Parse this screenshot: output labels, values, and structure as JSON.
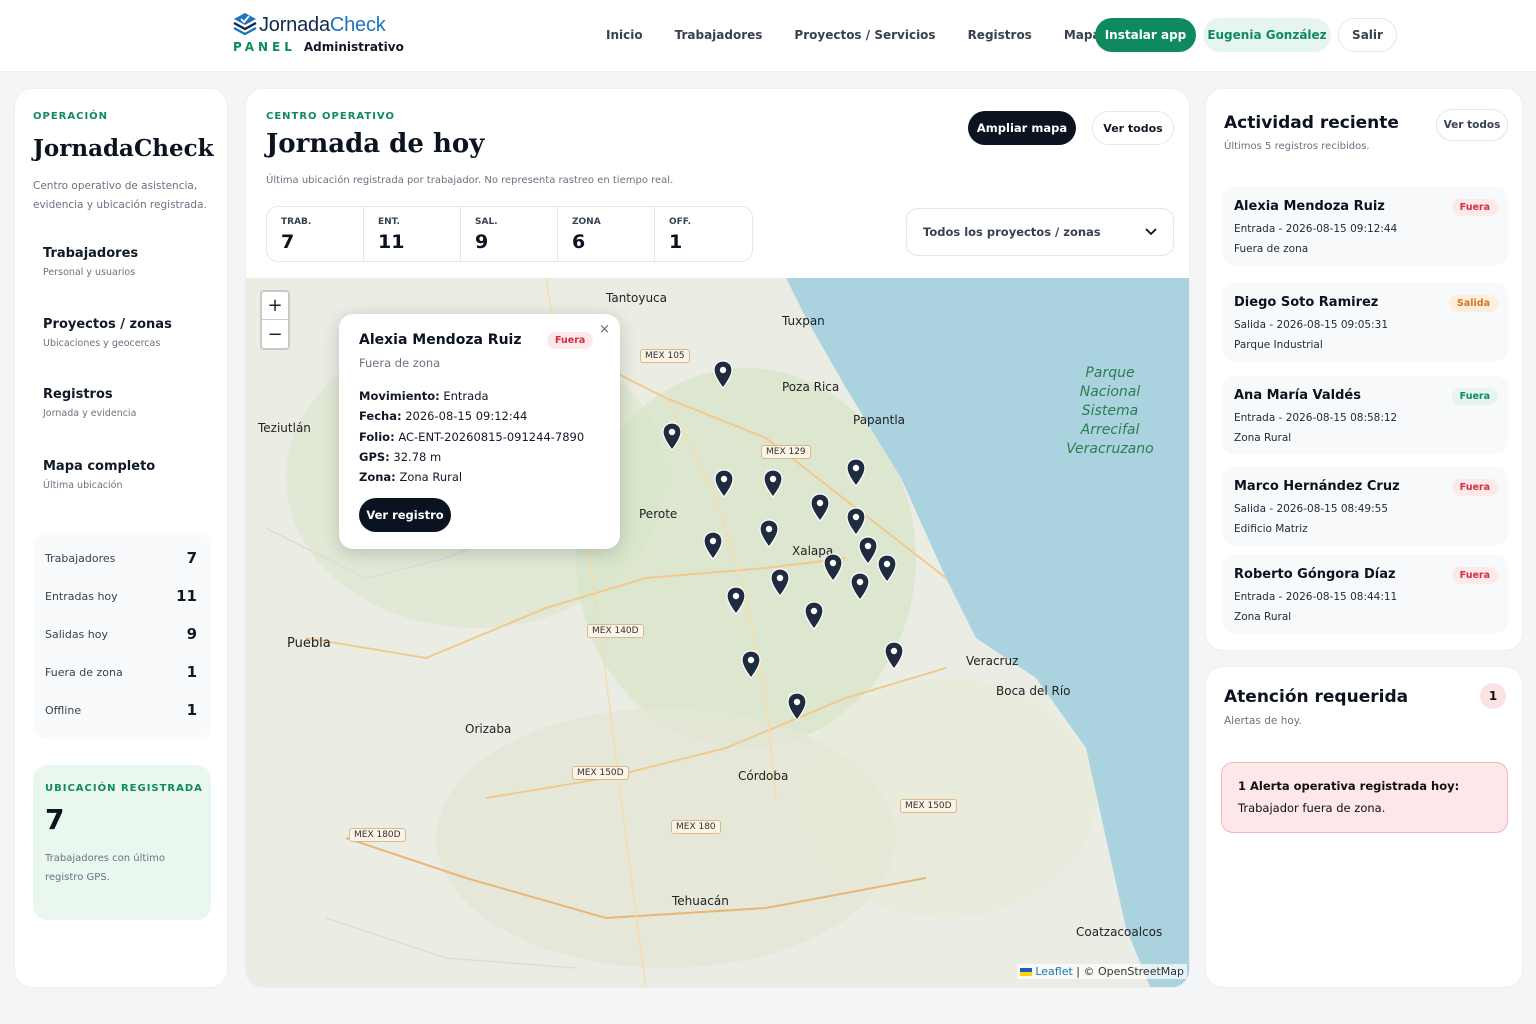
{
  "header": {
    "logo_name": "JornadaCheck",
    "logo_name_a": "Jornada",
    "logo_name_b": "Check",
    "logo_panel": "PANEL",
    "logo_admin": "Administrativo",
    "nav": [
      "Inicio",
      "Trabajadores",
      "Proyectos / Servicios",
      "Registros",
      "Mapa"
    ],
    "install_label": "Instalar app",
    "user_label": "Eugenia González",
    "exit_label": "Salir"
  },
  "sidebar": {
    "kicker": "OPERACIÓN",
    "brand": "JornadaCheck",
    "description": "Centro operativo de asistencia, evidencia y ubicación registrada.",
    "items": [
      {
        "title": "Trabajadores",
        "subtitle": "Personal y usuarios"
      },
      {
        "title": "Proyectos / zonas",
        "subtitle": "Ubicaciones y geocercas"
      },
      {
        "title": "Registros",
        "subtitle": "Jornada y evidencia"
      },
      {
        "title": "Mapa completo",
        "subtitle": "Última ubicación"
      }
    ],
    "stats": [
      {
        "label": "Trabajadores",
        "value": "7",
        "color": "#111827"
      },
      {
        "label": "Entradas hoy",
        "value": "11",
        "color": "#0f8a5f"
      },
      {
        "label": "Salidas hoy",
        "value": "9",
        "color": "#1e73be"
      },
      {
        "label": "Fuera de zona",
        "value": "1",
        "color": "#111827"
      },
      {
        "label": "Offline",
        "value": "1",
        "color": "#e0661a"
      }
    ],
    "location_box": {
      "kicker": "UBICACIÓN REGISTRADA",
      "value": "7",
      "text": "Trabajadores con último registro GPS."
    }
  },
  "main": {
    "kicker": "CENTRO OPERATIVO",
    "title": "Jornada de hoy",
    "subtitle": "Última ubicación registrada por trabajador. No representa rastreo en tiempo real.",
    "expand_label": "Ampliar mapa",
    "view_all_label": "Ver todos",
    "counters": [
      {
        "label": "TRAB.",
        "value": "7"
      },
      {
        "label": "ENT.",
        "value": "11"
      },
      {
        "label": "SAL.",
        "value": "9"
      },
      {
        "label": "ZONA",
        "value": "6"
      },
      {
        "label": "OFF.",
        "value": "1"
      }
    ],
    "filter_value": "Todos los proyectos / zonas"
  },
  "map": {
    "zoom_in": "+",
    "zoom_out": "−",
    "places": [
      "Tantoyuca",
      "Tuxpan",
      "Poza Rica",
      "Papantla",
      "Teziutlán",
      "Perote",
      "Xalapa",
      "Puebla",
      "Veracruz",
      "Boca del Río",
      "Orizaba",
      "Córdoba",
      "Tehuacán",
      "Coatzacoalcos"
    ],
    "roads": [
      "MEX 105",
      "MEX 129",
      "MEX 140D",
      "MEX 150D",
      "MEX 150D",
      "MEX 180",
      "MEX 180D"
    ],
    "park": "Parque Nacional Sistema Arrecifal Veracruzano",
    "attribution_leaflet": "Leaflet",
    "attribution_rest": " | © OpenStreetMap",
    "popup": {
      "name": "Alexia Mendoza Ruiz",
      "badge": "Fuera",
      "zone_status": "Fuera de zona",
      "close": "×",
      "fields": [
        {
          "label": "Movimiento:",
          "value": " Entrada"
        },
        {
          "label": "Fecha:",
          "value": " 2026-08-15 09:12:44"
        },
        {
          "label": "Folio:",
          "value": " AC-ENT-20260815-091244-7890"
        },
        {
          "label": "GPS:",
          "value": " 32.78 m"
        },
        {
          "label": "Zona:",
          "value": " Zona Rural"
        }
      ],
      "button": "Ver registro"
    }
  },
  "activity": {
    "title": "Actividad reciente",
    "subtitle": "Últimos 5 registros recibidos.",
    "view_all": "Ver todos",
    "items": [
      {
        "name": "Alexia Mendoza Ruiz",
        "badge": "Fuera",
        "move": "Entrada - 2026-08-15 09:12:44",
        "place": "Fuera de zona"
      },
      {
        "name": "Diego Soto Ramirez",
        "badge": "Salida",
        "move": "Salida - 2026-08-15 09:05:31",
        "place": "Parque Industrial"
      },
      {
        "name": "Ana María Valdés",
        "badge": "Fuera",
        "move": "Entrada - 2026-08-15 08:58:12",
        "place": "Zona Rural"
      },
      {
        "name": "Marco Hernández Cruz",
        "badge": "Fuera",
        "move": "Salida - 2026-08-15 08:49:55",
        "place": "Edificio Matriz"
      },
      {
        "name": "Roberto Góngora Díaz",
        "badge": "Fuera",
        "move": "Entrada - 2026-08-15 08:44:11",
        "place": "Zona Rural"
      }
    ]
  },
  "attention": {
    "title": "Atención requerida",
    "subtitle": "Alertas de hoy.",
    "count": "1",
    "alert_title": "1 Alerta operativa registrada hoy:",
    "alert_text": "Trabajador fuera de zona."
  }
}
